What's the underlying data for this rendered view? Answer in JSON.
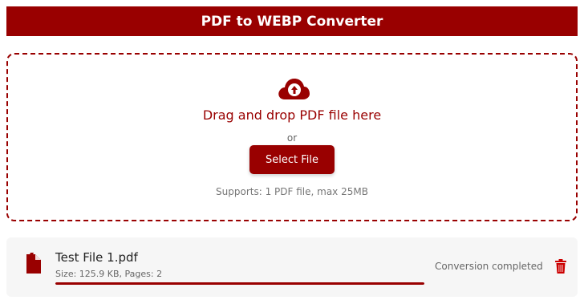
{
  "header": {
    "title": "PDF to WEBP Converter"
  },
  "dropzone": {
    "icon": "cloud-upload-icon",
    "drop_text": "Drag and drop PDF file here",
    "or_text": "or",
    "button_label": "Select File",
    "supports_text": "Supports: 1 PDF file, max 25MB"
  },
  "file": {
    "icon": "pdf-file-icon",
    "name": "Test File 1.pdf",
    "meta": "Size: 125.9 KB, Pages: 2",
    "progress": 1.0,
    "status": "Conversion completed",
    "delete_icon": "trash-icon"
  },
  "colors": {
    "accent": "#990000",
    "row_background": "#f6f6f6"
  }
}
